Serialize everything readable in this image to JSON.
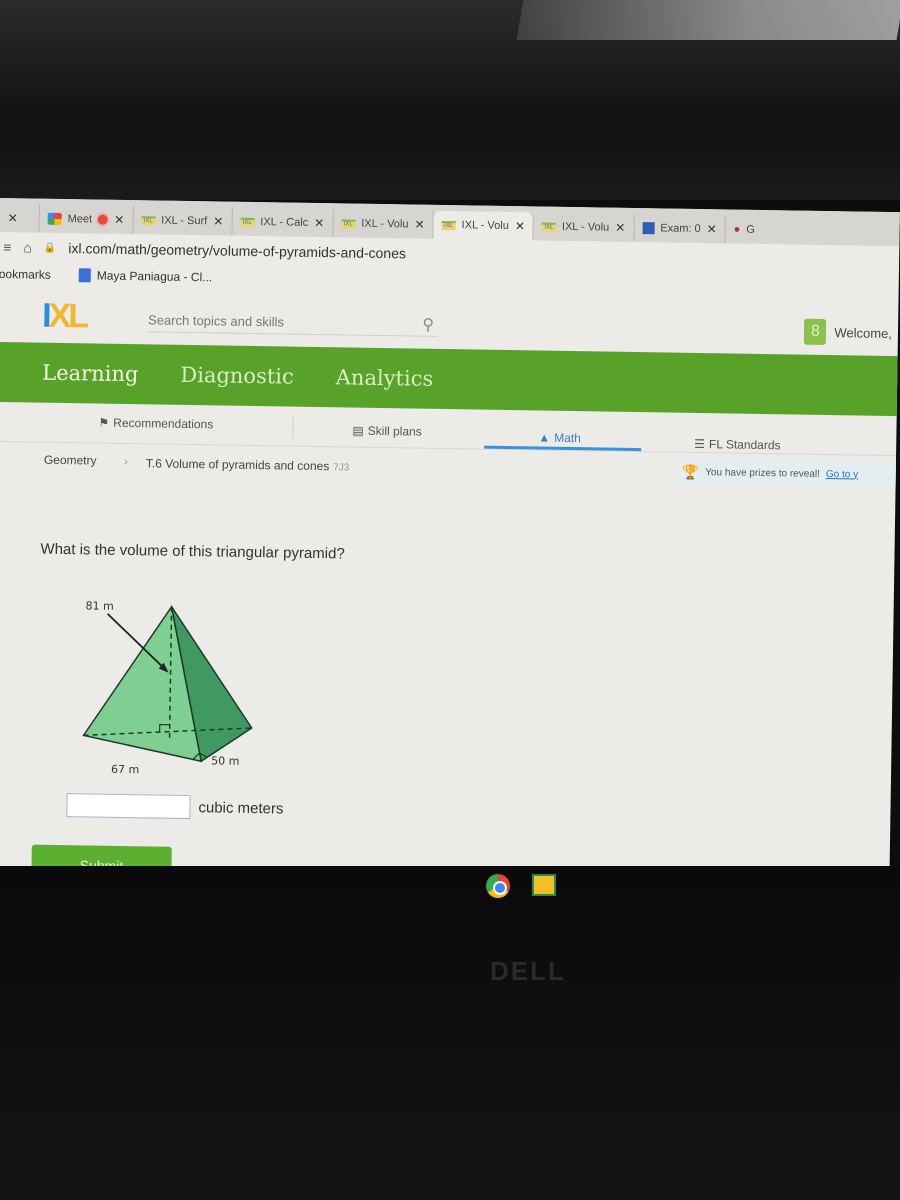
{
  "browser": {
    "tabs": [
      {
        "label": "",
        "icon": "close"
      },
      {
        "label": "Meet",
        "icon": "meet-icon",
        "recording": true
      },
      {
        "label": "IXL - Surf",
        "icon": "ixl-favicon"
      },
      {
        "label": "IXL - Calc",
        "icon": "ixl-favicon"
      },
      {
        "label": "IXL - Volu",
        "icon": "ixl-favicon"
      },
      {
        "label": "IXL - Volu",
        "icon": "ixl-favicon",
        "active": true
      },
      {
        "label": "IXL - Volu",
        "icon": "ixl-favicon"
      },
      {
        "label": "Exam: 0",
        "icon": "exam-favicon"
      },
      {
        "label": "G",
        "icon": "profile-favicon"
      }
    ],
    "url": "ixl.com/math/geometry/volume-of-pyramids-and-cones",
    "bookmarks_label": "ookmarks",
    "bookmarks": [
      {
        "label": "Maya Paniagua - Cl..."
      }
    ]
  },
  "header": {
    "logo_i": "I",
    "logo_xl": "XL",
    "search_placeholder": "Search topics and skills",
    "welcome": "Welcome,"
  },
  "main_nav": [
    "Learning",
    "Diagnostic",
    "Analytics"
  ],
  "sub_nav": [
    {
      "label": "Recommendations",
      "icon": "recommendations-icon"
    },
    {
      "label": "Skill plans",
      "icon": "skill-plans-icon"
    },
    {
      "label": "Math",
      "icon": "pyramid-icon",
      "active": true
    },
    {
      "label": "FL Standards",
      "icon": "standards-icon"
    }
  ],
  "breadcrumb": {
    "subject": "Geometry",
    "skill": "T.6 Volume of pyramids and cones",
    "code": "7J3"
  },
  "prizes": {
    "text": "You have prizes to reveal!",
    "link": "Go to y"
  },
  "question": {
    "prompt": "What is the volume of this triangular pyramid?",
    "height_label": "81 m",
    "base_leg1_label": "67 m",
    "base_leg2_label": "50 m",
    "answer_value": "",
    "unit": "cubic meters",
    "submit_label": "Submit"
  },
  "colors": {
    "ixl_green": "#58a22a",
    "pyramid_light": "#7fcf92",
    "pyramid_dark": "#3f9960",
    "active_blue": "#3a93d8"
  },
  "device": {
    "brand": "DELL"
  }
}
